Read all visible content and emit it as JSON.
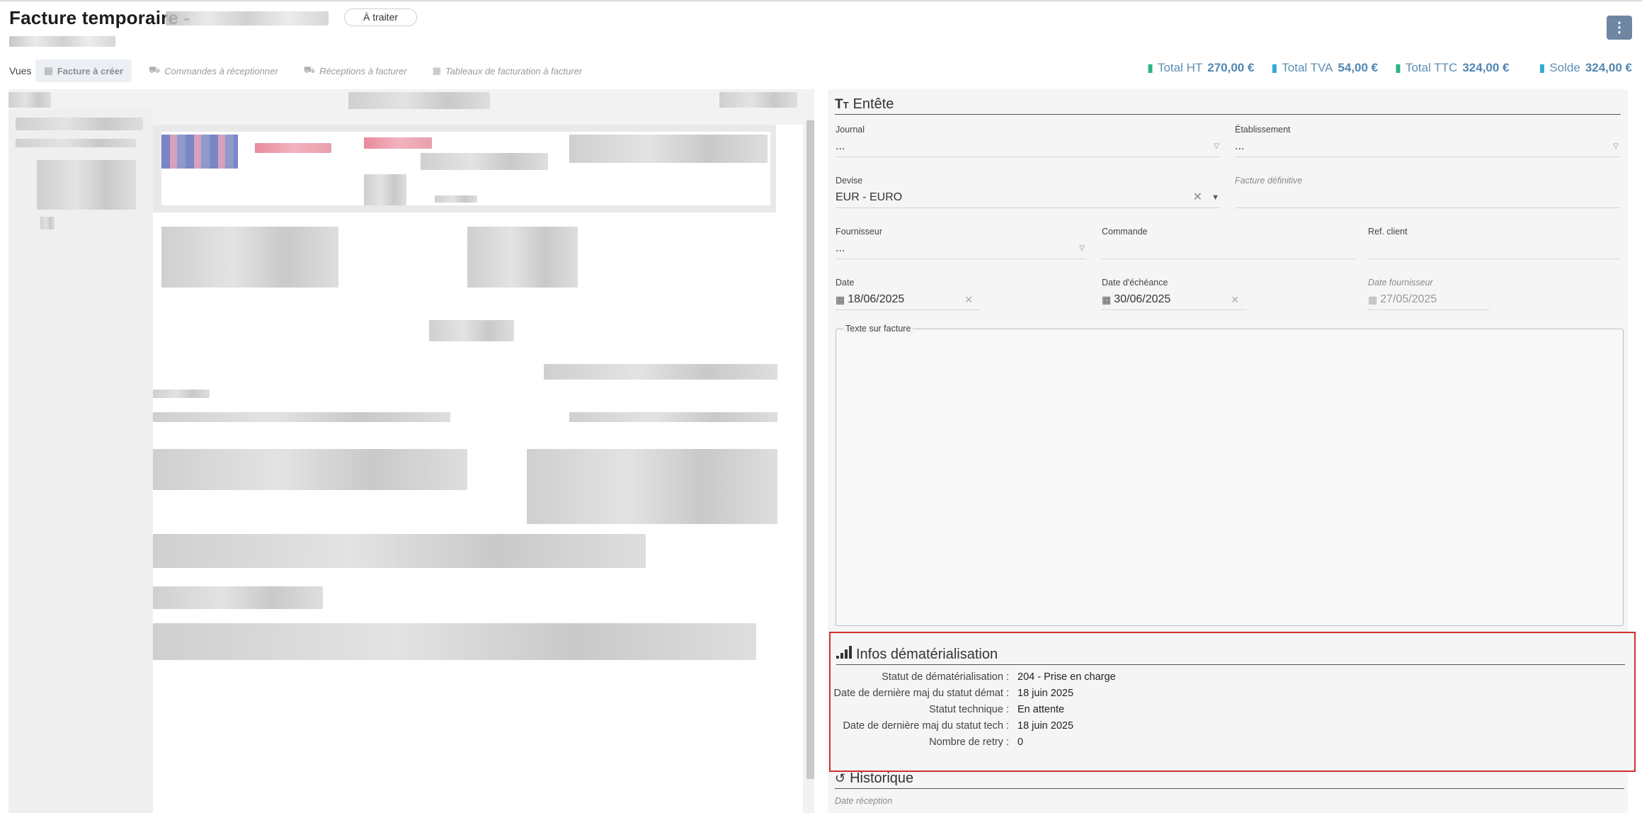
{
  "header": {
    "title": "Facture temporaire -",
    "status": "À traiter",
    "menu_glyph": "⋮"
  },
  "views": {
    "label": "Vues",
    "tabs": [
      {
        "label": "Facture à créer",
        "icon": "file-icon"
      },
      {
        "label": "Commandes à réceptionner",
        "icon": "truck-icon"
      },
      {
        "label": "Réceptions à facturer",
        "icon": "truck-icon"
      },
      {
        "label": "Tableaux de facturation à facturer",
        "icon": "table-icon"
      }
    ]
  },
  "totals": {
    "ht_label": "Total HT",
    "ht_value": "270,00 €",
    "tva_label": "Total TVA",
    "tva_value": "54,00 €",
    "ttc_label": "Total TTC",
    "ttc_value": "324,00 €",
    "solde_label": "Solde",
    "solde_value": "324,00 €"
  },
  "entete": {
    "title": "Entête",
    "journal_label": "Journal",
    "journal_value": "...",
    "etablissement_label": "Établissement",
    "etablissement_value": "...",
    "devise_label": "Devise",
    "devise_value": "EUR - EURO",
    "facture_def_label": "Facture définitive",
    "fournisseur_label": "Fournisseur",
    "fournisseur_value": "...",
    "commande_label": "Commande",
    "ref_client_label": "Ref. client",
    "date_label": "Date",
    "date_value": "18/06/2025",
    "echeance_label": "Date d'échéance",
    "echeance_value": "30/06/2025",
    "date_fournisseur_label": "Date fournisseur",
    "date_fournisseur_value": "27/05/2025",
    "texte_label": "Texte sur facture"
  },
  "demat": {
    "title": "Infos dématérialisation",
    "rows": [
      {
        "k": "Statut de dématérialisation :",
        "v": "204 - Prise en charge"
      },
      {
        "k": "Date de dernière maj du statut démat :",
        "v": "18 juin 2025"
      },
      {
        "k": "Statut technique :",
        "v": "En attente"
      },
      {
        "k": "Date de dernière maj du statut tech :",
        "v": "18 juin 2025"
      },
      {
        "k": "Nombre de retry :",
        "v": "0"
      }
    ]
  },
  "historique": {
    "title": "Historique",
    "sub": "Date réception"
  },
  "colors": {
    "accent": "#6f86a3",
    "totals_text": "#4f86b3",
    "highlight_border": "#d32f2f"
  }
}
